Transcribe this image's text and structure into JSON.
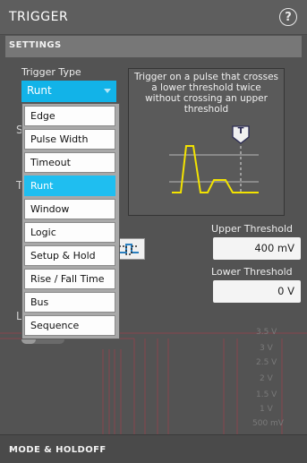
{
  "header": {
    "title": "TRIGGER",
    "help_icon": "?"
  },
  "settings": {
    "label": "SETTINGS"
  },
  "trigger_type": {
    "label": "Trigger Type",
    "selected": "Runt",
    "options": [
      "Edge",
      "Pulse Width",
      "Timeout",
      "Runt",
      "Window",
      "Logic",
      "Setup & Hold",
      "Rise / Fall Time",
      "Bus",
      "Sequence"
    ]
  },
  "diagram": {
    "description": "Trigger on a pulse that crosses a lower threshold twice without crossing an upper threshold",
    "marker_label": "T",
    "trace_color": "#f3e300"
  },
  "upper_threshold": {
    "label": "Upper Threshold",
    "value": "400 mV"
  },
  "lower_threshold": {
    "label": "Lower Threshold",
    "value": "0 V"
  },
  "background_partial": {
    "s": "S",
    "t": "T",
    "l": "L",
    "scale_labels": [
      "3.5 V",
      "3 V",
      "2.5 V",
      "2 V",
      "1.5 V",
      "1 V",
      "500 mV"
    ]
  },
  "footer": {
    "label": "MODE & HOLDOFF"
  },
  "colors": {
    "accent": "#12b3e8",
    "panel": "#535353",
    "trace": "#f3e300",
    "bg_trace": "#c8324a"
  }
}
